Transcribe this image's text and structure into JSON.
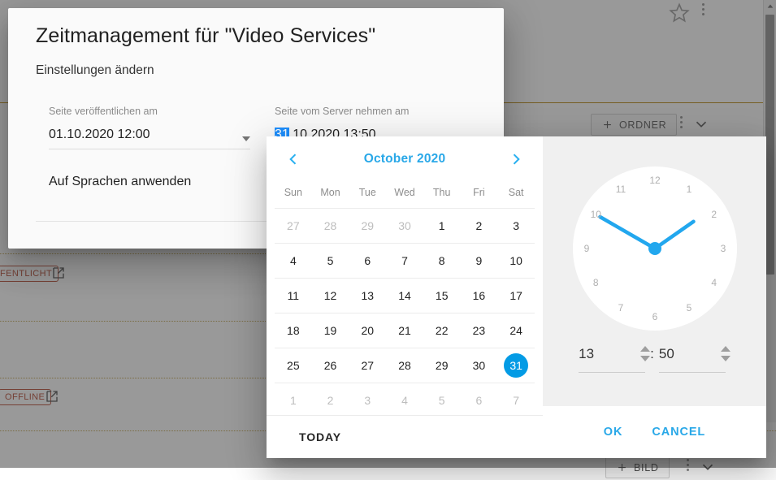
{
  "background": {
    "toolbar": {
      "folder_button_label": "ORDNER",
      "folder_button_icon": "plus-icon",
      "image_button_label": "BILD",
      "image_button_icon": "plus-icon",
      "star_icon": "star-outline-icon",
      "overflow_icon": "three-dot-vertical-icon",
      "chevron_icon": "chevron-down-icon"
    },
    "badges": [
      {
        "label": "FENTLICHT",
        "color": "#b3462f"
      },
      {
        "label": "OFFLINE",
        "color": "#b3462f"
      }
    ],
    "open_in_new_icon": "open-in-new-icon",
    "scrollbar_up_icon": "triangle-up-icon"
  },
  "dialog": {
    "title": "Zeitmanagement für \"Video Services\"",
    "subtitle": "Einstellungen ändern",
    "fields": [
      {
        "label": "Seite veröffentlichen am",
        "value": "01.10.2020 12:00",
        "selected_text": "",
        "rest_text": "01.10.2020 12:00",
        "caret": "caret-down-icon",
        "focused": false
      },
      {
        "label": "Seite vom Server nehmen am",
        "value": "31.10.2020 13:50",
        "selected_text": "31",
        "rest_text": ".10.2020 13:50",
        "caret": "caret-up-icon",
        "focused": true
      }
    ],
    "apply_languages_label": "Auf Sprachen anwenden"
  },
  "picker": {
    "calendar": {
      "prev_icon": "chevron-left-icon",
      "next_icon": "chevron-right-icon",
      "month_title": "October 2020",
      "weekdays": [
        "Sun",
        "Mon",
        "Tue",
        "Wed",
        "Thu",
        "Fri",
        "Sat"
      ],
      "weeks": [
        [
          {
            "d": "27",
            "out": true
          },
          {
            "d": "28",
            "out": true
          },
          {
            "d": "29",
            "out": true
          },
          {
            "d": "30",
            "out": true
          },
          {
            "d": "1",
            "out": false
          },
          {
            "d": "2",
            "out": false
          },
          {
            "d": "3",
            "out": false
          }
        ],
        [
          {
            "d": "4",
            "out": false
          },
          {
            "d": "5",
            "out": false
          },
          {
            "d": "6",
            "out": false
          },
          {
            "d": "7",
            "out": false
          },
          {
            "d": "8",
            "out": false
          },
          {
            "d": "9",
            "out": false
          },
          {
            "d": "10",
            "out": false
          }
        ],
        [
          {
            "d": "11",
            "out": false
          },
          {
            "d": "12",
            "out": false
          },
          {
            "d": "13",
            "out": false
          },
          {
            "d": "14",
            "out": false
          },
          {
            "d": "15",
            "out": false
          },
          {
            "d": "16",
            "out": false
          },
          {
            "d": "17",
            "out": false
          }
        ],
        [
          {
            "d": "18",
            "out": false
          },
          {
            "d": "19",
            "out": false
          },
          {
            "d": "20",
            "out": false
          },
          {
            "d": "21",
            "out": false
          },
          {
            "d": "22",
            "out": false
          },
          {
            "d": "23",
            "out": false
          },
          {
            "d": "24",
            "out": false
          }
        ],
        [
          {
            "d": "25",
            "out": false
          },
          {
            "d": "26",
            "out": false
          },
          {
            "d": "27",
            "out": false
          },
          {
            "d": "28",
            "out": false
          },
          {
            "d": "29",
            "out": false
          },
          {
            "d": "30",
            "out": false
          },
          {
            "d": "31",
            "out": false,
            "selected": true
          }
        ],
        [
          {
            "d": "1",
            "out": true
          },
          {
            "d": "2",
            "out": true
          },
          {
            "d": "3",
            "out": true
          },
          {
            "d": "4",
            "out": true
          },
          {
            "d": "5",
            "out": true
          },
          {
            "d": "6",
            "out": true
          },
          {
            "d": "7",
            "out": true
          }
        ]
      ],
      "selected_day": "31",
      "today_label": "TODAY",
      "accent_color": "#039be5"
    },
    "clock": {
      "hour_numbers": [
        "12",
        "1",
        "2",
        "3",
        "4",
        "5",
        "6",
        "7",
        "8",
        "9",
        "10",
        "11"
      ],
      "hour_value": "13",
      "minute_value": "50",
      "separator": ":",
      "hour_hand_angle_deg": 55,
      "minute_hand_angle_deg": 300,
      "hand_color": "#22a7ee",
      "up_arrow_icon": "triangle-up-icon",
      "down_arrow_icon": "triangle-down-icon"
    },
    "actions": {
      "ok_label": "OK",
      "cancel_label": "CANCEL"
    }
  }
}
